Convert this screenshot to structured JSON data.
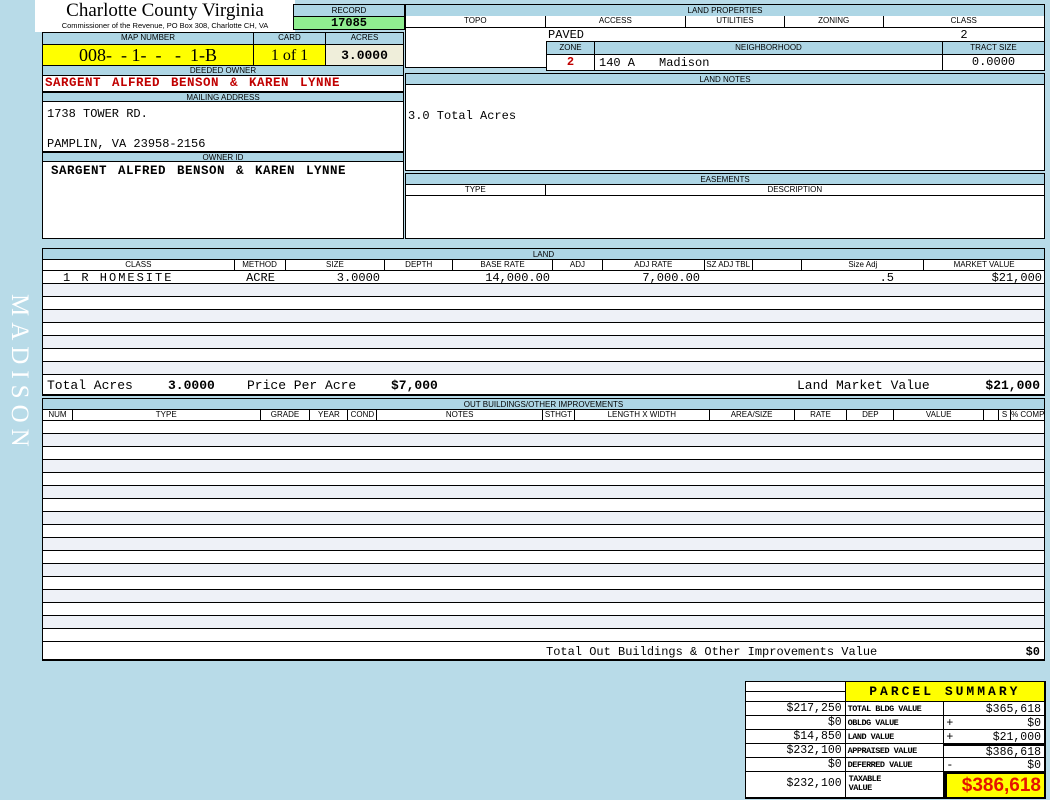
{
  "sidebar": {
    "district": "MADISON"
  },
  "header": {
    "county": "Charlotte County Virginia",
    "commissioner": "Commissioner of the Revenue, PO Box 308, Charlotte CH, VA",
    "record_label": "RECORD",
    "record_value": "17085",
    "map_number_label": "MAP NUMBER",
    "map_number_value": "008-  - 1-  -   -  1-B",
    "card_label": "CARD",
    "card_value": "1 of 1",
    "acres_label": "ACRES",
    "acres_value": "3.0000"
  },
  "owner": {
    "deeded_owner_label": "DEEDED OWNER",
    "deeded_owner": "SARGENT ALFRED BENSON & KAREN LYNNE",
    "mailing_address_label": "MAILING ADDRESS",
    "address_line1": "1738 TOWER RD.",
    "address_line2": "PAMPLIN, VA 23958-2156",
    "owner_id_label": "OWNER ID",
    "owner_id": "SARGENT ALFRED BENSON & KAREN LYNNE"
  },
  "land_properties": {
    "title": "LAND PROPERTIES",
    "col_topo": "TOPO",
    "col_access": "ACCESS",
    "col_utilities": "UTILITIES",
    "col_zoning": "ZONING",
    "col_class": "CLASS",
    "access_value": "PAVED",
    "class_value": "2",
    "zone_label": "ZONE",
    "zone_value": "2",
    "neighborhood_label": "NEIGHBORHOOD",
    "neighborhood_code": "140 A",
    "neighborhood_name": "Madison",
    "tract_size_label": "TRACT SIZE",
    "tract_size_value": "0.0000"
  },
  "land_notes": {
    "title": "LAND NOTES",
    "note": "3.0 Total Acres"
  },
  "easements": {
    "title": "EASEMENTS",
    "type_label": "TYPE",
    "description_label": "DESCRIPTION"
  },
  "land_table": {
    "title": "LAND",
    "columns": [
      "CLASS",
      "METHOD",
      "SIZE",
      "DEPTH",
      "BASE RATE",
      "ADJ",
      "ADJ RATE",
      "SZ ADJ TBL",
      "",
      "Size Adj",
      "MARKET VALUE"
    ],
    "row": {
      "class": "1 R HOMESITE",
      "method": "ACRE",
      "size": "3.0000",
      "depth": "",
      "base_rate": "14,000.00",
      "adj": "",
      "adj_rate": "7,000.00",
      "sz_adj_tbl": "",
      "size_adj": ".5",
      "market_value": "$21,000"
    },
    "total_acres_label": "Total Acres",
    "total_acres_value": "3.0000",
    "price_per_acre_label": "Price Per Acre",
    "price_per_acre_value": "$7,000",
    "land_market_value_label": "Land Market Value",
    "land_market_value": "$21,000"
  },
  "out_buildings": {
    "title": "OUT BUILDINGS/OTHER IMPROVEMENTS",
    "columns": [
      "NUM",
      "TYPE",
      "GRADE",
      "YEAR",
      "COND",
      "NOTES",
      "STHGT",
      "LENGTH X WIDTH",
      "AREA/SIZE",
      "RATE",
      "DEP",
      "VALUE",
      "",
      "S",
      "% COMP"
    ],
    "total_label": "Total Out Buildings & Other Improvements Value",
    "total_value": "$0"
  },
  "parcel_summary": {
    "title": "PARCEL SUMMARY",
    "rows": [
      {
        "prior": "$217,250",
        "label": "TOTAL BLDG VALUE",
        "sign": "",
        "value": "$365,618"
      },
      {
        "prior": "$0",
        "label": "OBLDG VALUE",
        "sign": "+",
        "value": "$0"
      },
      {
        "prior": "$14,850",
        "label": "LAND VALUE",
        "sign": "+",
        "value": "$21,000"
      },
      {
        "prior": "$232,100",
        "label": "APPRAISED VALUE",
        "sign": "",
        "value": "$386,618"
      },
      {
        "prior": "$0",
        "label": "DEFERRED VALUE",
        "sign": "-",
        "value": "$0"
      },
      {
        "prior": "$232,100",
        "label": "TAXABLE VALUE",
        "sign": "",
        "value": "$386,618"
      }
    ]
  },
  "colors": {
    "page_blue": "#b8dbe8",
    "band_blue": "#aed6e5",
    "record_green": "#90ee90",
    "highlight_yellow": "#ffff00",
    "acres_beige": "#efeeda",
    "owner_red": "#c00000",
    "taxable_red": "#e51400",
    "stripe_gray": "#eef1f7"
  }
}
